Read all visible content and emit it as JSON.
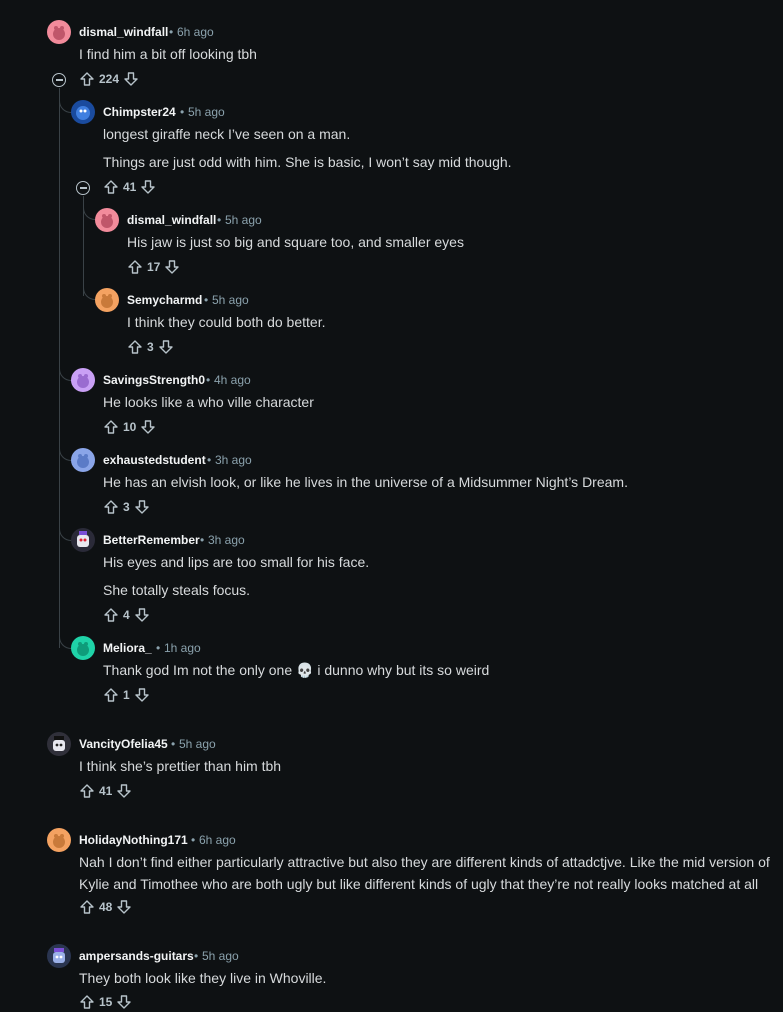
{
  "comments": [
    {
      "user": "dismal_windfall",
      "time": "6h ago",
      "lines": [
        "I find him a bit off looking tbh"
      ],
      "votes": "224"
    },
    {
      "user": "Chimpster24",
      "time": "5h ago",
      "lines": [
        "longest giraffe neck I’ve seen on a man.",
        "Things are just odd with him. She is basic, I won’t say mid though."
      ],
      "votes": "41"
    },
    {
      "user": "dismal_windfall",
      "time": "5h ago",
      "lines": [
        "His jaw is just so big and square too, and smaller eyes"
      ],
      "votes": "17"
    },
    {
      "user": "Semycharmd",
      "time": "5h ago",
      "lines": [
        "I think they could both do better."
      ],
      "votes": "3"
    },
    {
      "user": "SavingsStrength0",
      "time": "4h ago",
      "lines": [
        "He looks like a who ville character"
      ],
      "votes": "10"
    },
    {
      "user": "exhaustedstudent",
      "time": "3h ago",
      "lines": [
        "He has an elvish look, or like he lives in the universe of a Midsummer Night’s Dream."
      ],
      "votes": "3"
    },
    {
      "user": "BetterRemember",
      "time": "3h ago",
      "lines": [
        "His eyes and lips are too small for his face.",
        "She totally steals focus."
      ],
      "votes": "4"
    },
    {
      "user": "Meliora_",
      "time": "1h ago",
      "lines": [
        "Thank god Im not the only one 💀 i dunno why but its so weird"
      ],
      "votes": "1"
    },
    {
      "user": "VancityOfelia45",
      "time": "5h ago",
      "lines": [
        "I think she’s prettier than him tbh"
      ],
      "votes": "41"
    },
    {
      "user": "HolidayNothing171",
      "time": "6h ago",
      "lines": [
        "Nah I don’t find either particularly attractive but also they are different kinds of attadctjve. Like the mid version of Kylie and Timothee who are both ugly but like different kinds of ugly that they’re not really looks matched at all"
      ],
      "votes": "48"
    },
    {
      "user": "ampersands-guitars",
      "time": "5h ago",
      "lines": [
        "They both look like they live in Whoville."
      ],
      "votes": "15"
    }
  ],
  "dot": "•",
  "colors": {
    "bg": "#0e1113",
    "text": "#d7dadc",
    "meta": "#8ba2ad",
    "thread": "#3a4247"
  }
}
